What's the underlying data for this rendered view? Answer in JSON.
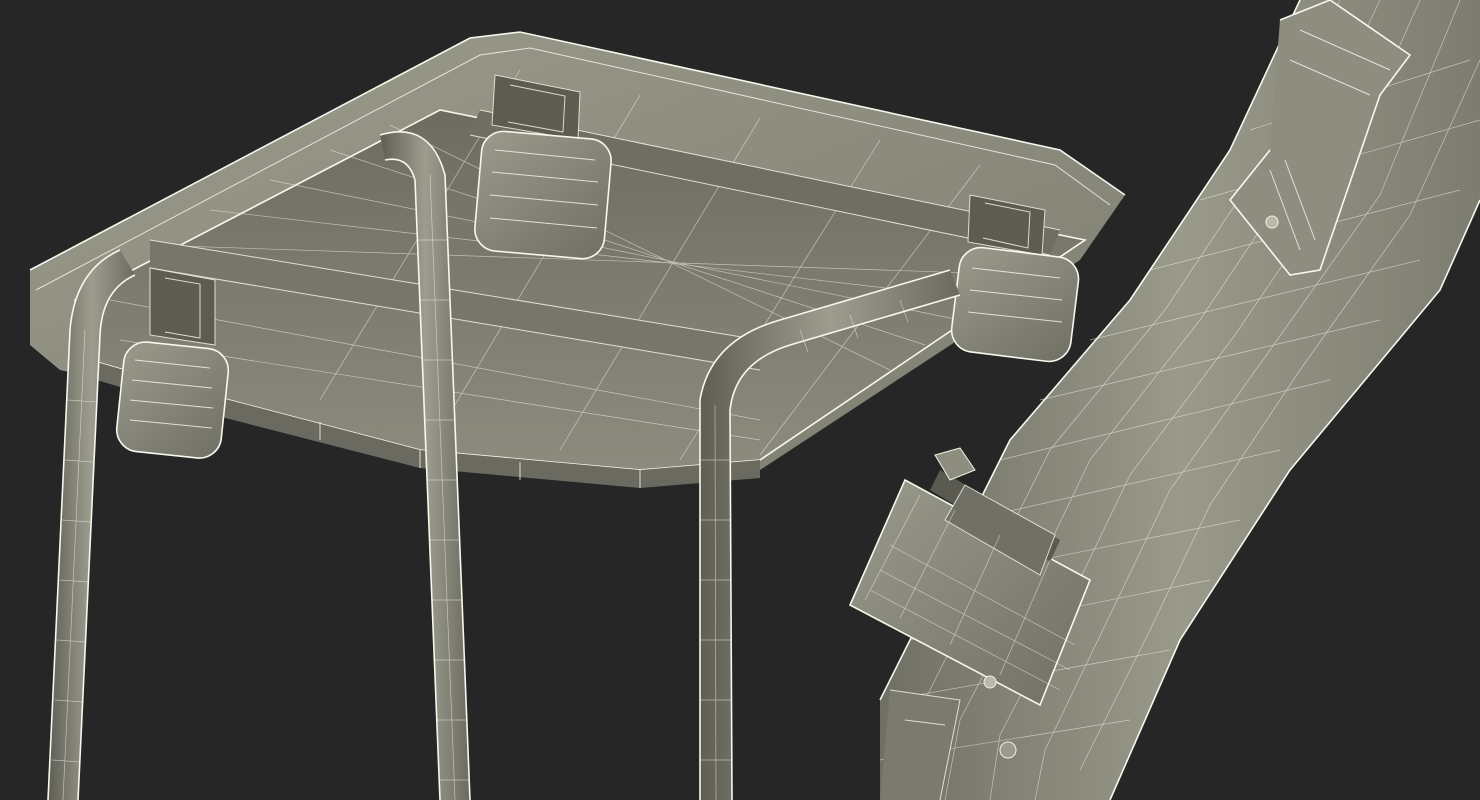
{
  "scene": {
    "background": "#262626",
    "surface_color": "#8a8a7c",
    "surface_light": "#a3a394",
    "surface_dark": "#5f5f55",
    "wire_color": "#f1f1e6"
  }
}
